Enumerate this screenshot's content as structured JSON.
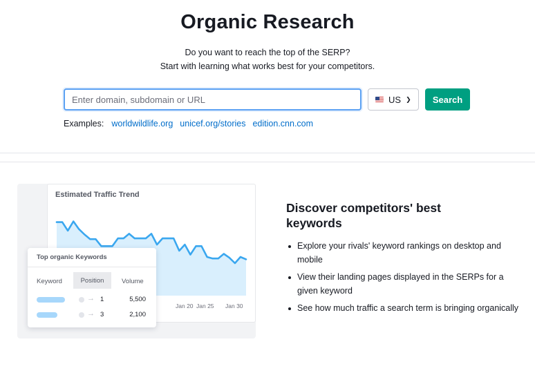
{
  "hero": {
    "title": "Organic Research",
    "subtitle_line1": "Do you want to reach the top of the SERP?",
    "subtitle_line2": "Start with learning what works best for your competitors."
  },
  "search": {
    "placeholder": "Enter domain, subdomain or URL",
    "value": "",
    "country": "US",
    "country_flag_icon": "us-flag-icon",
    "button_label": "Search",
    "button_color": "#009f81"
  },
  "examples": {
    "label": "Examples:",
    "links": [
      "worldwildlife.org",
      "unicef.org/stories",
      "edition.cnn.com"
    ]
  },
  "illustration": {
    "chart_title": "Estimated Traffic Trend",
    "x_labels": [
      "Jan 20",
      "Jan 25",
      "Jan 30"
    ],
    "trend": [
      0.95,
      0.95,
      0.84,
      0.96,
      0.86,
      0.79,
      0.73,
      0.73,
      0.64,
      0.64,
      0.64,
      0.74,
      0.74,
      0.8,
      0.74,
      0.74,
      0.74,
      0.8,
      0.66,
      0.74,
      0.74,
      0.74,
      0.58,
      0.66,
      0.53,
      0.64,
      0.64,
      0.5,
      0.48,
      0.48,
      0.54,
      0.49,
      0.42,
      0.5,
      0.47
    ],
    "line_color": "#3aa7ef",
    "fill_color": "#d9effd",
    "keywords_card": {
      "title": "Top organic Keywords",
      "headers": [
        "Keyword",
        "Position",
        "Volume"
      ],
      "rows": [
        {
          "position": "1",
          "volume": "5,500"
        },
        {
          "position": "3",
          "volume": "2,100"
        }
      ]
    }
  },
  "feature": {
    "title": "Discover competitors' best keywords",
    "bullets": [
      "Explore your rivals' keyword rankings on desktop and mobile",
      "View their landing pages displayed in the SERPs for a given keyword",
      "See how much traffic a search term is bringing organically"
    ]
  }
}
